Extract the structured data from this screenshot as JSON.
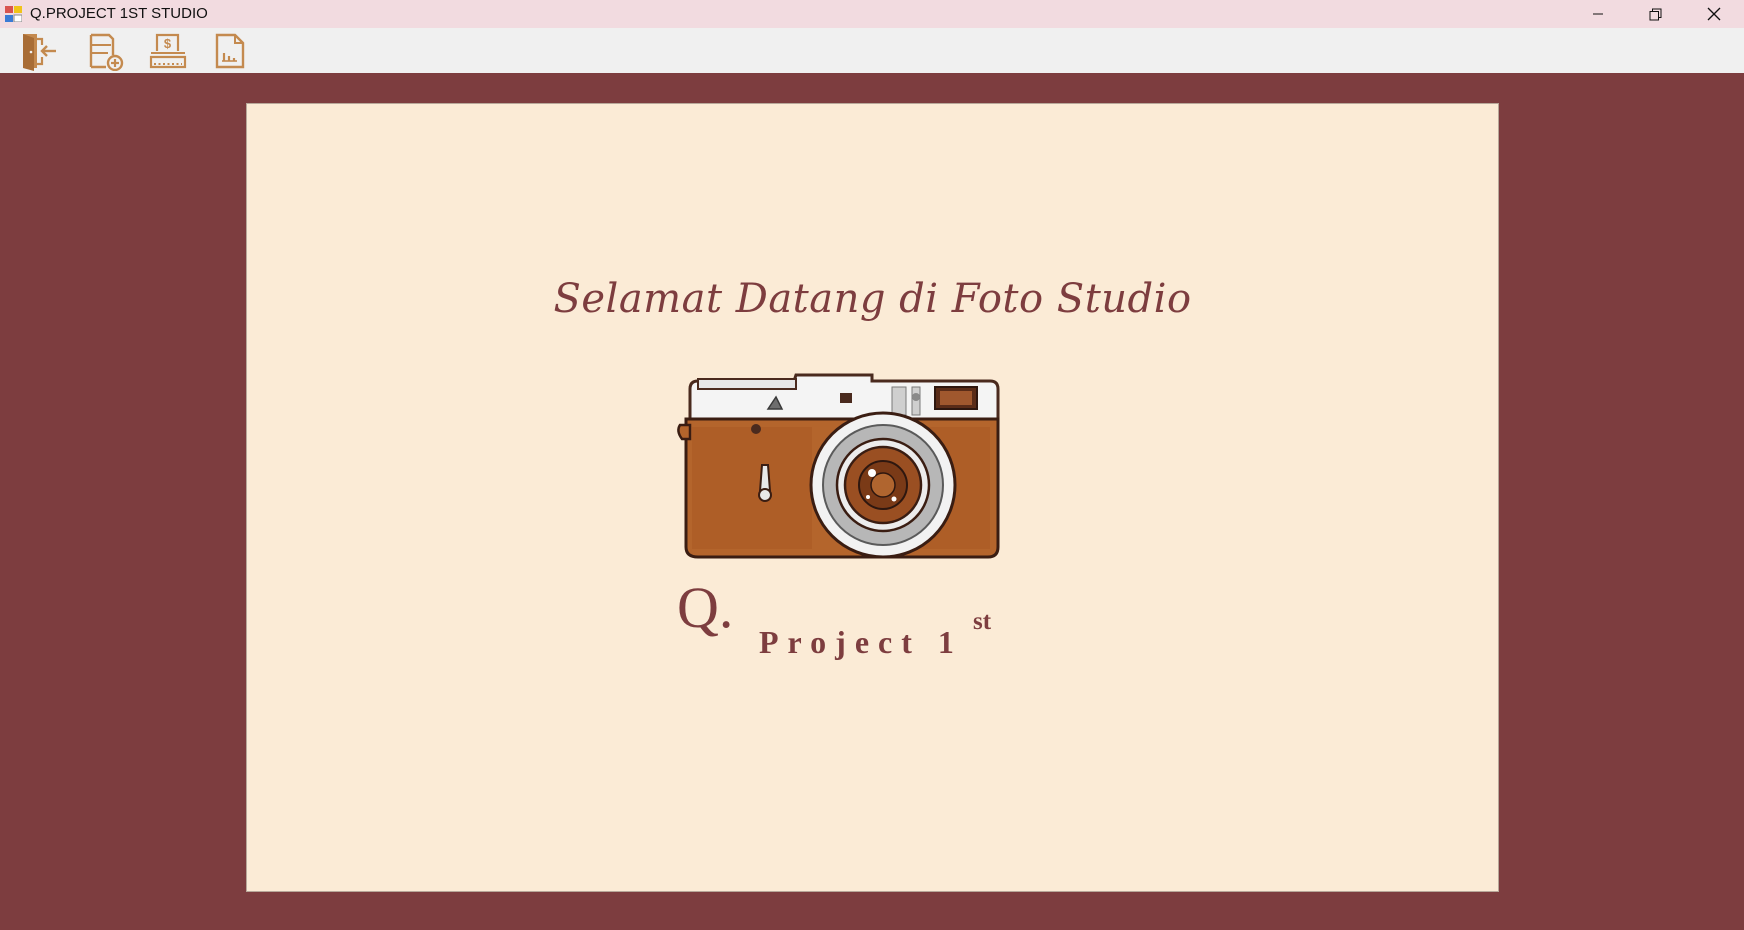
{
  "window": {
    "title": "Q.PROJECT 1ST STUDIO",
    "background_color": "#7d3d3f",
    "titlebar_color": "#f2dbe0",
    "controls": [
      "minimize-icon",
      "restore-icon",
      "close-icon"
    ]
  },
  "toolbar": {
    "buttons": [
      {
        "icon": "exit-door-icon"
      },
      {
        "icon": "add-record-icon"
      },
      {
        "icon": "payment-icon"
      },
      {
        "icon": "report-icon"
      }
    ],
    "icon_color": "#c48a4f"
  },
  "panel": {
    "background_color": "#fbebd6",
    "welcome_text": "Selamat Datang di Foto Studio",
    "image": "camera-illustration",
    "brand": {
      "q": "Q.",
      "name": "Project 1",
      "sup": "st"
    },
    "text_color": "#7d3d3f"
  }
}
